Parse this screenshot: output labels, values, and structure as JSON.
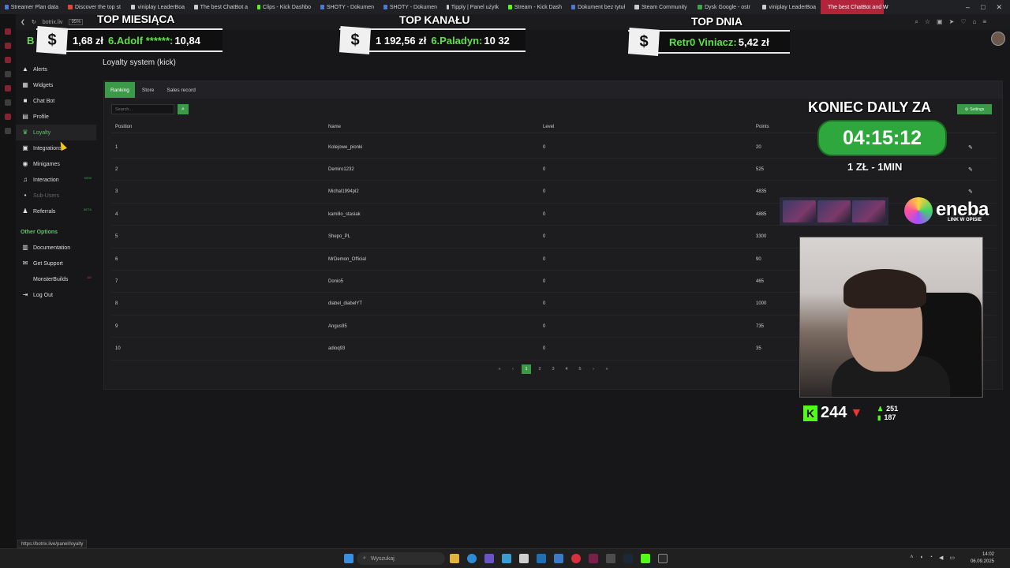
{
  "browser": {
    "tabs": [
      {
        "label": "Streamer Plan data",
        "color": "#4a7ad4"
      },
      {
        "label": "Discover the top st",
        "color": "#e0453a"
      },
      {
        "label": "viniplay LeaderBoa",
        "color": "#cccccc"
      },
      {
        "label": "The best ChatBot a",
        "color": "#cccccc"
      },
      {
        "label": "Clips - Kick Dashbo",
        "color": "#53fc18"
      },
      {
        "label": "SHOTY - Dokumen",
        "color": "#4a7ad4"
      },
      {
        "label": "SHOTY - Dokumen",
        "color": "#4a7ad4"
      },
      {
        "label": "Tipply | Panel użytk",
        "color": "#cccccc"
      },
      {
        "label": "Stream - Kick Dash",
        "color": "#53fc18"
      },
      {
        "label": "Dokument bez tytuł",
        "color": "#4a7ad4"
      },
      {
        "label": "Steam Community",
        "color": "#cccccc"
      },
      {
        "label": "Dysk Google - ostr",
        "color": "#3fa34d"
      },
      {
        "label": "viniplay LeaderBoa",
        "color": "#cccccc"
      },
      {
        "label": "The best ChatBot and W",
        "color": "#ffffff",
        "active": true
      }
    ],
    "url": "botrix.liv",
    "zoom": "95%",
    "status_url": "https://botrix.live/panel/loyalty"
  },
  "overlay": {
    "goals": [
      {
        "title": "TOP MIESIĄCA",
        "coin": "$",
        "value": "1,68 zł",
        "name": "6.Adolf ******:",
        "amount": "10,84"
      },
      {
        "title": "TOP KANAŁU",
        "coin": "$",
        "value": "1 192,56 zł",
        "name": "6.Paladyn:",
        "amount": "10 32"
      },
      {
        "title": "TOP DNIA",
        "coin": "$",
        "value": "",
        "name": "Retr0 Viniacz:",
        "amount": "5,42 zł"
      }
    ],
    "left_fragment": "B",
    "koniec": "KONIEC DAILY ZA",
    "timer": "04:15:12",
    "rate": "1 ZŁ - 1MIN",
    "eneba": "eneba",
    "eneba_sub": "LINK W OPISIE",
    "kick": {
      "icon": "K",
      "viewers": "244",
      "followers": "251",
      "subs": "187"
    }
  },
  "sidebar": {
    "items": [
      {
        "label": "Alerts",
        "icon": "alert-triangle-icon",
        "glyph": "▲"
      },
      {
        "label": "Widgets",
        "icon": "widgets-icon",
        "glyph": "▦"
      },
      {
        "label": "Chat Bot",
        "icon": "chat-bubble-icon",
        "glyph": "■"
      },
      {
        "label": "Profile",
        "icon": "profile-card-icon",
        "glyph": "▤"
      },
      {
        "label": "Loyalty",
        "icon": "trophy-icon",
        "glyph": "♛",
        "active": true
      },
      {
        "label": "Integrations",
        "icon": "integrations-icon",
        "glyph": "▣"
      },
      {
        "label": "Minigames",
        "icon": "gamepad-icon",
        "glyph": "◉"
      },
      {
        "label": "Interaction",
        "icon": "music-note-icon",
        "glyph": "♫",
        "badge": "NEW"
      },
      {
        "label": "Sub-Users",
        "icon": "sub-users-icon",
        "glyph": "•",
        "dim": true
      },
      {
        "label": "Referrals",
        "icon": "users-icon",
        "glyph": "♟",
        "badge": "BETA"
      }
    ],
    "other_title": "Other Options",
    "other": [
      {
        "label": "Documentation",
        "icon": "book-icon",
        "glyph": "▥"
      },
      {
        "label": "Get Support",
        "icon": "support-icon",
        "glyph": "✉"
      },
      {
        "label": "MonsterBuilds",
        "icon": "monster-icon",
        "glyph": "",
        "badge": "AD"
      },
      {
        "label": "Log Out",
        "icon": "logout-icon",
        "glyph": "⇥"
      }
    ]
  },
  "main": {
    "title": "Loyalty system (kick)",
    "tabs": [
      {
        "label": "Ranking",
        "active": true
      },
      {
        "label": "Store"
      },
      {
        "label": "Sales record"
      }
    ],
    "search_placeholder": "Search...",
    "settings_label": "Settings",
    "columns": {
      "position": "Position",
      "name": "Name",
      "level": "Level",
      "points": "Points"
    },
    "rows": [
      {
        "position": "1",
        "name": "Kolejowe_pionki",
        "level": "0",
        "points": "20"
      },
      {
        "position": "2",
        "name": "Demiro1232",
        "level": "0",
        "points": "525"
      },
      {
        "position": "3",
        "name": "Michal1994pl2",
        "level": "0",
        "points": "4835"
      },
      {
        "position": "4",
        "name": "kamillo_stasiak",
        "level": "0",
        "points": "4885"
      },
      {
        "position": "5",
        "name": "Shepo_PL",
        "level": "0",
        "points": "3300"
      },
      {
        "position": "6",
        "name": "MrDemon_Official",
        "level": "0",
        "points": "90"
      },
      {
        "position": "7",
        "name": "Donio5",
        "level": "0",
        "points": "465"
      },
      {
        "position": "8",
        "name": "diabel_diabelYT",
        "level": "0",
        "points": "1000"
      },
      {
        "position": "9",
        "name": "Angus95",
        "level": "0",
        "points": "735"
      },
      {
        "position": "10",
        "name": "adioq93",
        "level": "0",
        "points": "35"
      }
    ],
    "pager": {
      "first": "«",
      "prev": "‹",
      "pages": [
        "1",
        "2",
        "3",
        "4",
        "5"
      ],
      "current": "1",
      "next": "›",
      "last": "»"
    }
  },
  "taskbar": {
    "search_placeholder": "Wyszukaj",
    "time": "14:02",
    "date": "06.09.2025"
  }
}
